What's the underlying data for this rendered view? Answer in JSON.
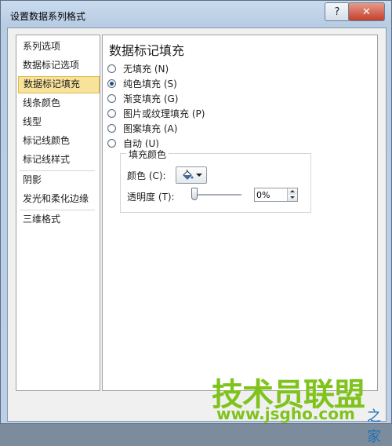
{
  "window": {
    "title": "设置数据系列格式",
    "help_label": "?",
    "close_label": "✕"
  },
  "nav": {
    "items": [
      {
        "label": "系列选项"
      },
      {
        "label": "数据标记选项"
      },
      {
        "label": "数据标记填充",
        "selected": true
      },
      {
        "label": "线条颜色"
      },
      {
        "label": "线型"
      },
      {
        "label": "标记线颜色"
      },
      {
        "label": "标记线样式"
      },
      {
        "label": "阴影"
      },
      {
        "label": "发光和柔化边缘"
      },
      {
        "label": "三维格式"
      }
    ]
  },
  "panel": {
    "title": "数据标记填充",
    "options": [
      {
        "label": "无填充 (N)",
        "checked": false
      },
      {
        "label": "纯色填充 (S)",
        "checked": true
      },
      {
        "label": "渐变填充 (G)",
        "checked": false
      },
      {
        "label": "图片或纹理填充 (P)",
        "checked": false
      },
      {
        "label": "图案填充 (A)",
        "checked": false
      },
      {
        "label": "自动 (U)",
        "checked": false
      }
    ],
    "fill_group": {
      "title": "填充颜色",
      "color_label": "颜色 (C):",
      "transparency_label": "透明度 (T):",
      "transparency_value": "0%",
      "transparency_level": 0
    }
  },
  "colors": {
    "accent_selected": "#f7e39a",
    "radio_dot": "#1f4f8a",
    "bucket": "#3a6fb3"
  },
  "watermark": {
    "logo": "技术员联盟",
    "url": "www.jsgho.com",
    "suffix": "之家"
  }
}
